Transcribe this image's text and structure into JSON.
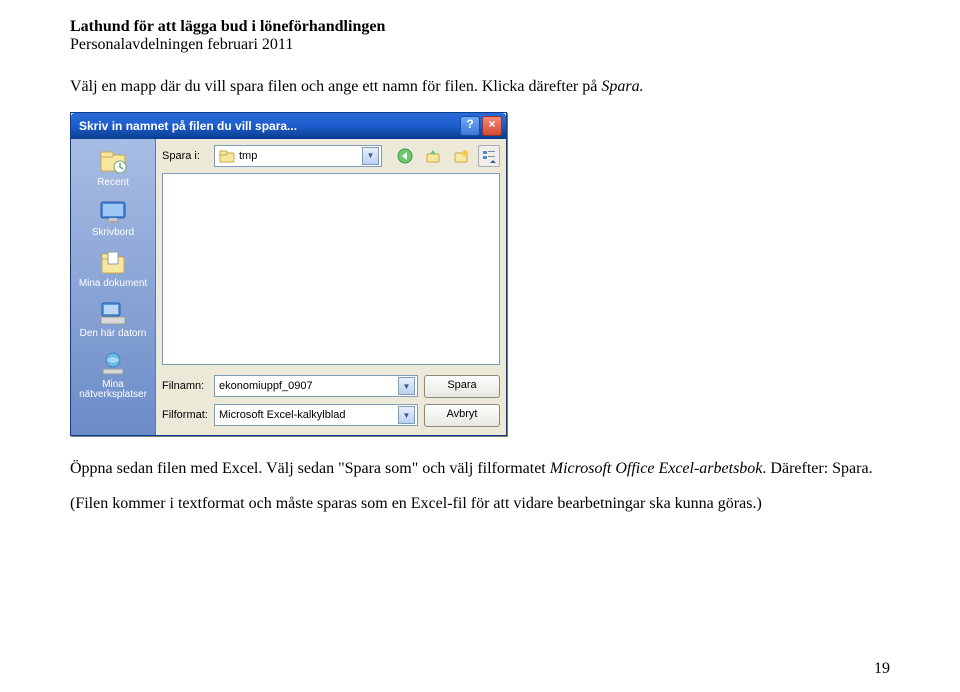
{
  "header": {
    "title": "Lathund för att lägga bud i löneförhandlingen",
    "subtitle": "Personalavdelningen februari 2011"
  },
  "paragraphs": {
    "p1_a": "Välj en mapp där du vill spara filen och ange ett namn för filen. Klicka därefter på ",
    "p1_b": "Spara.",
    "p2_a": "Öppna sedan filen med Excel. Välj sedan \"Spara som\" och välj filformatet ",
    "p2_b": "Microsoft Office Excel-arbetsbok",
    "p2_c": ". Därefter: Spara.",
    "p3": "(Filen kommer i textformat och måste sparas som en Excel-fil för att vidare bearbetningar ska kunna göras.)"
  },
  "dialog": {
    "title": "Skriv in namnet på filen du vill spara...",
    "help_glyph": "?",
    "close_glyph": "×",
    "lookin_label": "Spara i:",
    "lookin_value": "tmp",
    "filename_label": "Filnamn:",
    "filename_value": "ekonomiuppf_0907",
    "filetype_label": "Filformat:",
    "filetype_value": "Microsoft Excel-kalkylblad",
    "btn_save": "Spara",
    "btn_cancel": "Avbryt",
    "places": [
      {
        "label": "Recent",
        "icon": "recent"
      },
      {
        "label": "Skrivbord",
        "icon": "desktop"
      },
      {
        "label": "Mina dokument",
        "icon": "mydocs"
      },
      {
        "label": "Den här datorn",
        "icon": "mycomputer"
      },
      {
        "label": "Mina nätverksplatser",
        "icon": "network"
      }
    ]
  },
  "page_number": "19"
}
